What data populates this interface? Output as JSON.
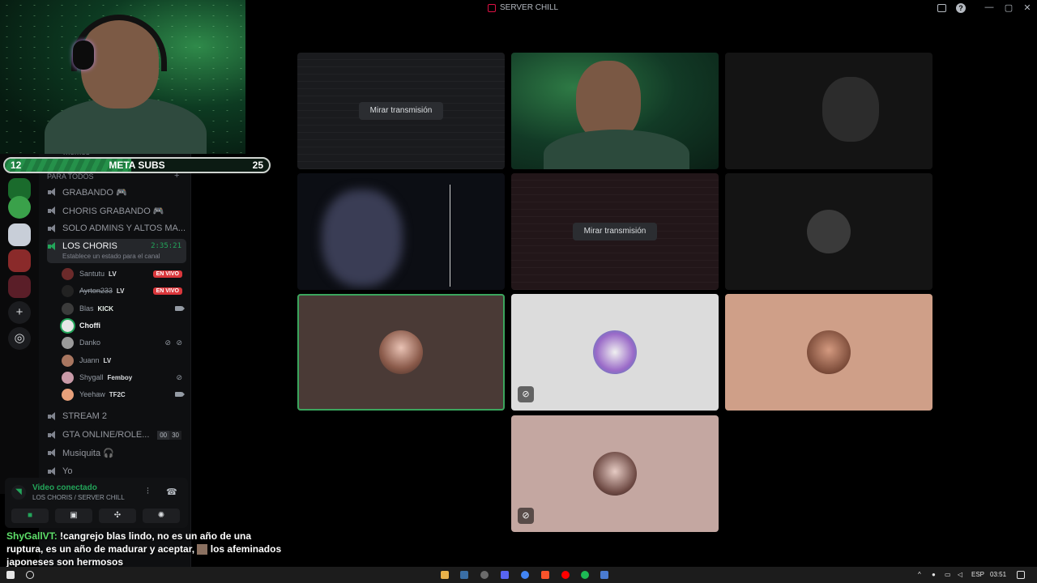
{
  "window": {
    "title": "SERVER CHILL"
  },
  "overlay": {
    "goal": {
      "left": "12",
      "title": "META SUBS",
      "right": "25",
      "progress": 0.48
    }
  },
  "sidebar": {
    "partial_channel": "memes",
    "category": "PARA TODOS",
    "channels": [
      {
        "name": "GRABANDO 🎮"
      },
      {
        "name": "CHORIS GRABANDO 🎮"
      },
      {
        "name": "SOLO ADMINS Y ALTOS MA..."
      },
      {
        "name": "LOS CHORIS",
        "timer": "2:35:21",
        "status": "Establece un estado para el canal"
      },
      {
        "name": "STREAM 2"
      },
      {
        "name": "GTA ONLINE/ROLE...",
        "count_a": "00",
        "count_b": "30"
      },
      {
        "name": "Musiquita 🎧"
      },
      {
        "name": "Yo"
      }
    ],
    "users": [
      {
        "name": "Santutu",
        "tag": "LV",
        "badge": "EN VIVO"
      },
      {
        "name": "Ayrton233",
        "tag": "LV",
        "badge": "EN VIVO"
      },
      {
        "name": "Blas",
        "tag": "KICK"
      },
      {
        "name": "Choffi"
      },
      {
        "name": "Danko"
      },
      {
        "name": "Juann",
        "tag": "LV"
      },
      {
        "name": "Shygall",
        "tag": "Femboy"
      },
      {
        "name": "Yeehaw",
        "tag": "TF2C"
      }
    ]
  },
  "voice": {
    "title": "Video conectado",
    "subtitle": "LOS CHORIS / SERVER CHILL"
  },
  "chat": {
    "user": "ShyGallVT:",
    "message_a": " !cangrejo blas lindo, no es un año de una ruptura, es un año de madurar y aceptar,",
    "message_b": " los afeminados japoneses son hermosos"
  },
  "grid": {
    "watch_label": "Mirar transmisión"
  },
  "taskbar": {
    "lang": "ESP",
    "time": "03:51"
  },
  "colors": {
    "accent_green": "#23a55a",
    "live_red": "#da373c"
  }
}
